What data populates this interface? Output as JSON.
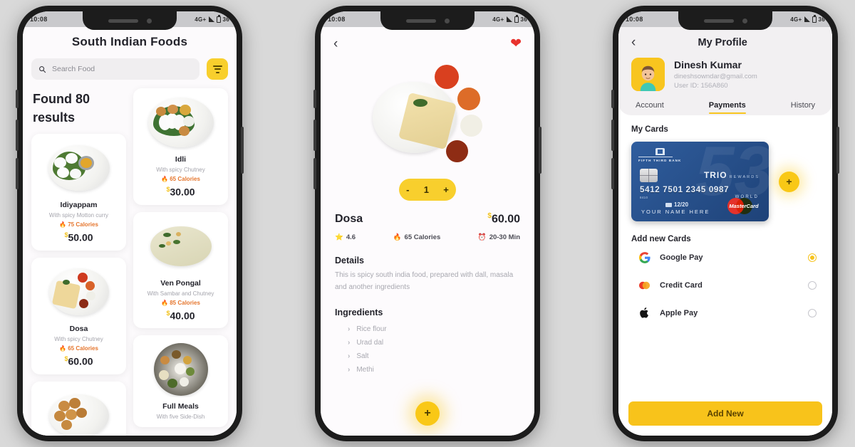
{
  "statusbar": {
    "time": "10:08",
    "network": "4G+",
    "battery": "36"
  },
  "phone1": {
    "title": "South Indian Foods",
    "search": {
      "placeholder": "Search Food",
      "icon": "search-icon"
    },
    "filter_icon": "filter-icon",
    "found_text": "Found 80 results",
    "currency": "$",
    "left_items": [
      {
        "name": "Idiyappam",
        "desc": "With spicy Motton curry",
        "calories": "75 Calories",
        "price": "50.00",
        "image": "idiyappam-plate"
      },
      {
        "name": "Dosa",
        "desc": "With spicy Chutney",
        "calories": "65 Calories",
        "price": "60.00",
        "image": "dosa-plate"
      },
      {
        "name": "",
        "desc": "",
        "calories": "",
        "price": "",
        "image": "bonda-plate"
      }
    ],
    "right_items": [
      {
        "name": "Idli",
        "desc": "With spicy Chutney",
        "calories": "65 Calories",
        "price": "30.00",
        "image": "idli-plate"
      },
      {
        "name": "Ven Pongal",
        "desc": "With Sambar and Chutney",
        "calories": "85 Calories",
        "price": "40.00",
        "image": "pongal-plate"
      },
      {
        "name": "Full Meals",
        "desc": "With five Side-Dish",
        "calories": "",
        "price": "",
        "image": "fullmeals-plate"
      }
    ]
  },
  "phone2": {
    "back_icon": "chevron-left-icon",
    "favorite_icon": "heart-icon",
    "quantity": {
      "minus": "-",
      "value": "1",
      "plus": "+"
    },
    "dish": "Dosa",
    "currency": "$",
    "price": "60.00",
    "rating": "4.6",
    "calories": "65 Calories",
    "time": "20-30 Min",
    "details_heading": "Details",
    "details_text": "This is spicy south india food, prepared with dall, masala and another ingredients",
    "ingredients_heading": "Ingredients",
    "ingredients": [
      "Rice flour",
      "Urad dal",
      "Salt",
      "Methi"
    ],
    "fab_label": "+"
  },
  "phone3": {
    "back_icon": "chevron-left-icon",
    "title": "My Profile",
    "user": {
      "name": "Dinesh Kumar",
      "email": "dineshsowndar@gmail.com",
      "user_id": "User ID: 156A860",
      "avatar": "user-avatar"
    },
    "tabs": [
      {
        "label": "Account",
        "active": false
      },
      {
        "label": "Payments",
        "active": true
      },
      {
        "label": "History",
        "active": false
      }
    ],
    "my_cards_label": "My Cards",
    "card": {
      "bank": "FIFTH THIRD BANK",
      "brand": "TRIO",
      "brand_sub": "REWARDS",
      "number": "5412 7501 2345 0987",
      "number_sub": "8410",
      "tier": "WORLD",
      "expiry": "12/20",
      "holder": "YOUR NAME HERE",
      "network": "MasterCard"
    },
    "add_card_fab": "+",
    "add_new_cards_label": "Add new Cards",
    "payment_options": [
      {
        "label": "Google Pay",
        "icon": "google-icon",
        "selected": true
      },
      {
        "label": "Credit Card",
        "icon": "mastercard-icon",
        "selected": false
      },
      {
        "label": "Apple Pay",
        "icon": "apple-icon",
        "selected": false
      }
    ],
    "add_new_button": "Add New"
  }
}
